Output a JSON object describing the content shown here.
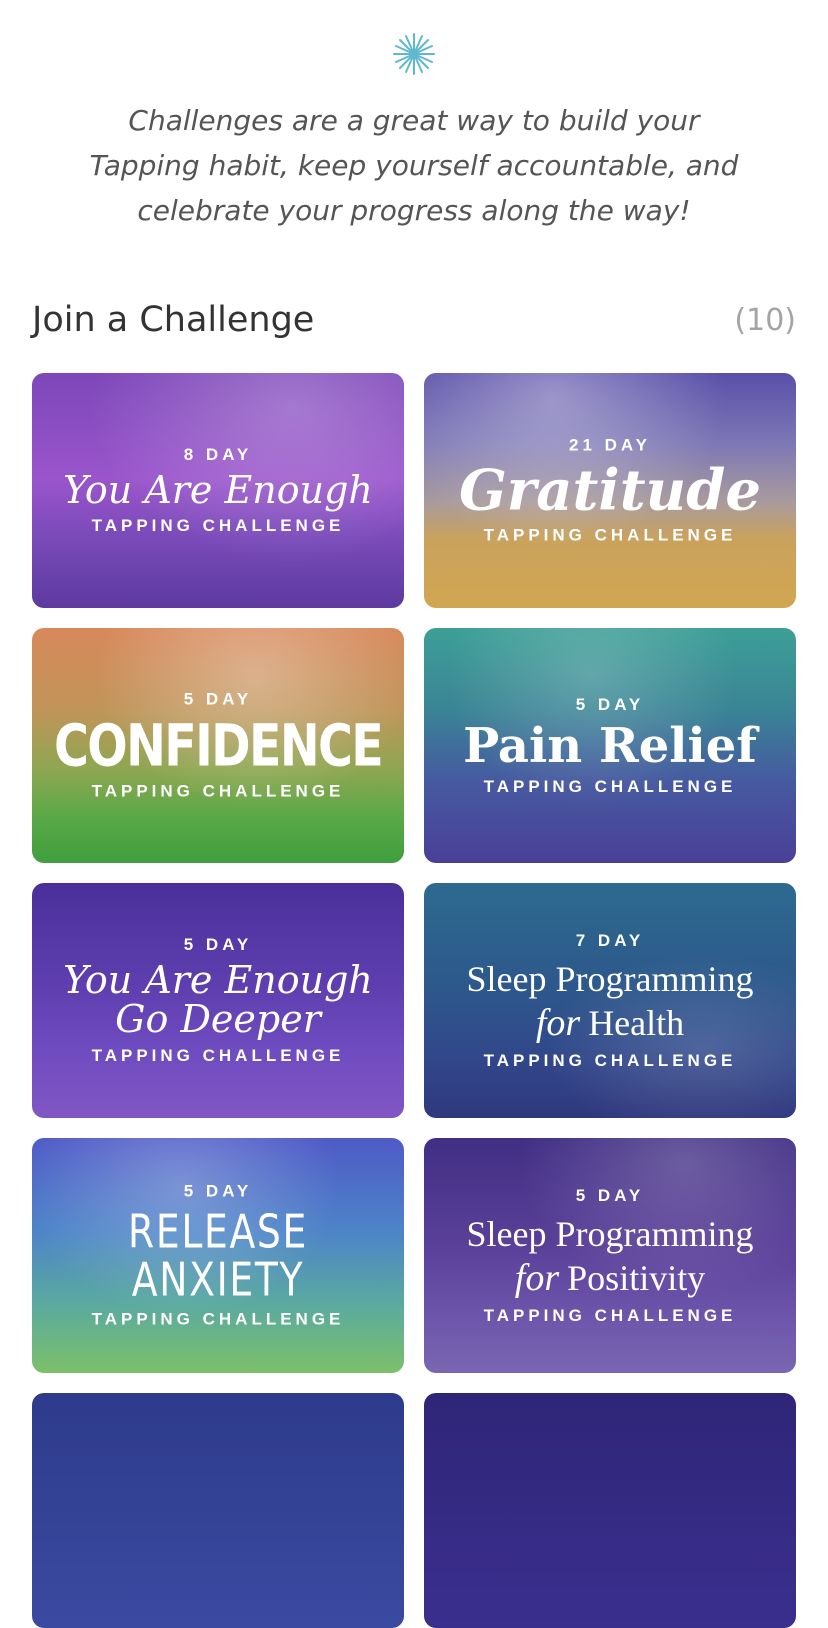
{
  "header": {
    "star_icon": "sparkle-icon",
    "accent_color": "#5fb8cf",
    "intro_lines": [
      "Challenges are a great way to build your",
      "Tapping habit, keep yourself accountable, and",
      "celebrate your progress along the way!"
    ]
  },
  "section": {
    "title": "Join a Challenge",
    "count": "(10)"
  },
  "challenges": [
    {
      "days": "8 DAY",
      "name": "You Are Enough",
      "subtitle": "TAPPING CHALLENGE"
    },
    {
      "days": "21 DAY",
      "name": "Gratitude",
      "subtitle": "TAPPING CHALLENGE"
    },
    {
      "days": "5 DAY",
      "name": "CONFIDENCE",
      "subtitle": "TAPPING CHALLENGE"
    },
    {
      "days": "5 DAY",
      "name": "Pain Relief",
      "subtitle": "TAPPING CHALLENGE"
    },
    {
      "days": "5 DAY",
      "name_line1": "You Are Enough",
      "name_line2": "Go Deeper",
      "subtitle": "TAPPING CHALLENGE"
    },
    {
      "days": "7 DAY",
      "name_line1": "Sleep Programming",
      "name_for": "for",
      "name_line2": "Health",
      "subtitle": "TAPPING CHALLENGE"
    },
    {
      "days": "5 DAY",
      "name": "RELEASE ANXIETY",
      "subtitle": "TAPPING CHALLENGE"
    },
    {
      "days": "5 DAY",
      "name_line1": "Sleep Programming",
      "name_for": "for",
      "name_line2": "Positivity",
      "subtitle": "TAPPING CHALLENGE"
    }
  ]
}
